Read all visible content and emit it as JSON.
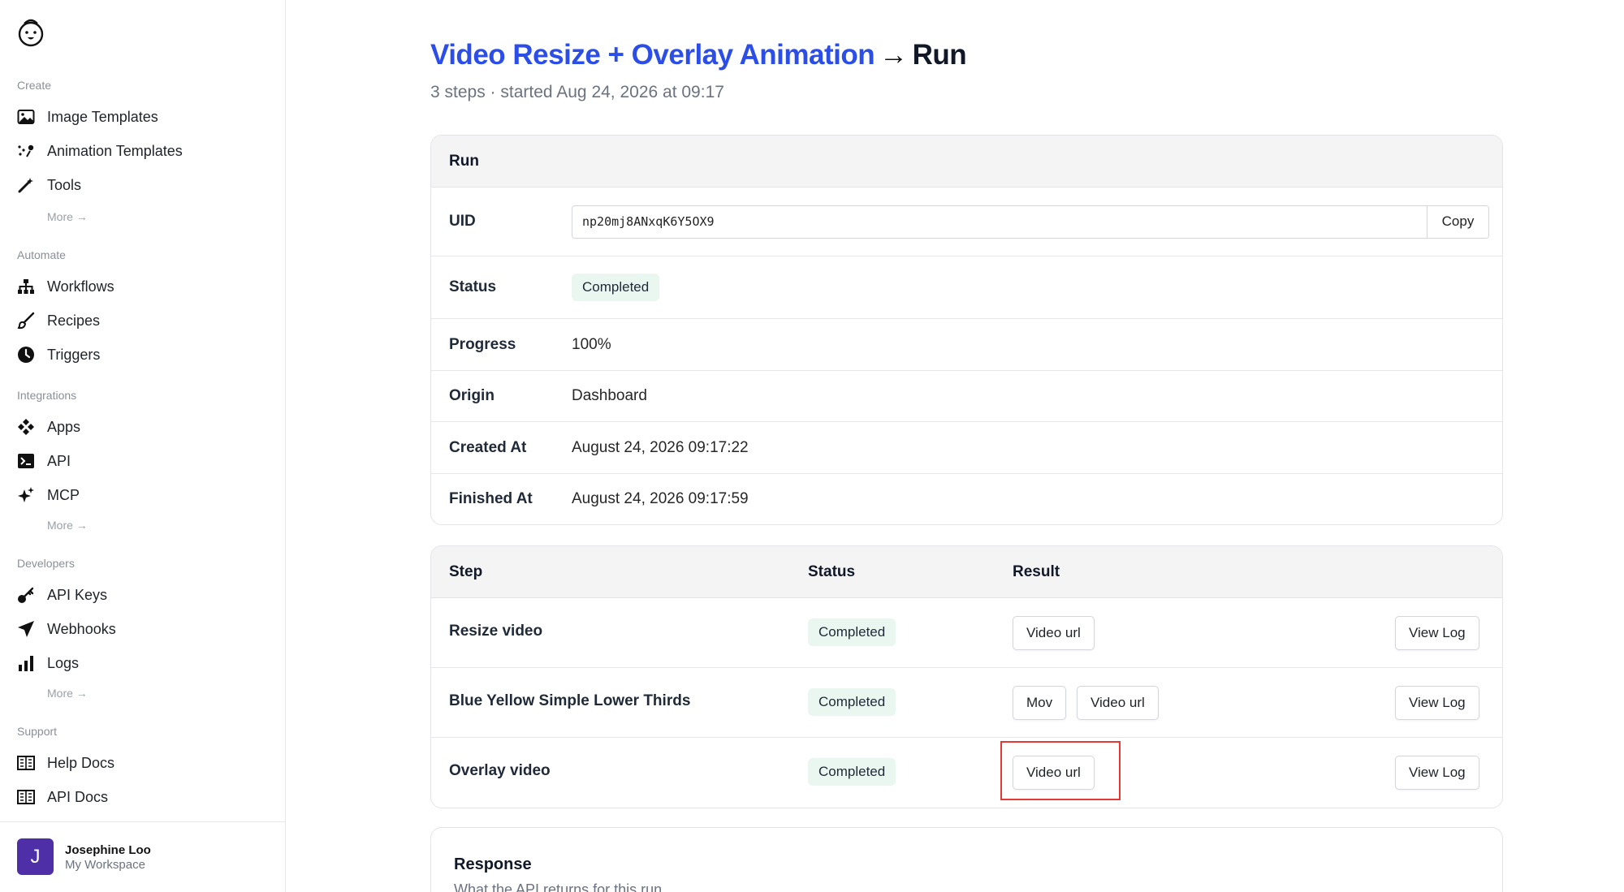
{
  "sidebar": {
    "logo_icon": "bear-logo-icon",
    "sections": {
      "create": {
        "label": "Create",
        "items": [
          {
            "label": "Image Templates",
            "icon": "image-icon"
          },
          {
            "label": "Animation Templates",
            "icon": "animation-icon"
          },
          {
            "label": "Tools",
            "icon": "magic-wand-icon"
          }
        ],
        "more": "More →"
      },
      "automate": {
        "label": "Automate",
        "items": [
          {
            "label": "Workflows",
            "icon": "workflow-icon"
          },
          {
            "label": "Recipes",
            "icon": "brush-icon"
          },
          {
            "label": "Triggers",
            "icon": "clock-icon"
          }
        ]
      },
      "integrations": {
        "label": "Integrations",
        "items": [
          {
            "label": "Apps",
            "icon": "apps-icon"
          },
          {
            "label": "API",
            "icon": "terminal-icon"
          },
          {
            "label": "MCP",
            "icon": "sparkle-icon"
          }
        ],
        "more": "More →"
      },
      "developers": {
        "label": "Developers",
        "items": [
          {
            "label": "API Keys",
            "icon": "key-icon"
          },
          {
            "label": "Webhooks",
            "icon": "send-icon"
          },
          {
            "label": "Logs",
            "icon": "bar-chart-icon"
          }
        ],
        "more": "More →"
      },
      "support": {
        "label": "Support",
        "items": [
          {
            "label": "Help Docs",
            "icon": "book-icon"
          },
          {
            "label": "API Docs",
            "icon": "book-icon"
          }
        ]
      }
    },
    "user": {
      "initial": "J",
      "name": "Josephine Loo",
      "workspace": "My Workspace",
      "avatar_color": "#4f2fa8"
    }
  },
  "header": {
    "workflow_link": "Video Resize + Overlay Animation",
    "arrow": "→",
    "page": "Run",
    "subtitle": "3 steps · started Aug 24, 2026 at 09:17"
  },
  "run": {
    "title": "Run",
    "uid_label": "UID",
    "uid_value": "np20mj8ANxqK6Y5OX9",
    "copy_label": "Copy",
    "status_label": "Status",
    "status_value": "Completed",
    "progress_label": "Progress",
    "progress_value": "100%",
    "origin_label": "Origin",
    "origin_value": "Dashboard",
    "created_label": "Created At",
    "created_value": "August 24, 2026 09:17:22",
    "finished_label": "Finished At",
    "finished_value": "August 24, 2026 09:17:59"
  },
  "steps": {
    "headers": {
      "step": "Step",
      "status": "Status",
      "result": "Result"
    },
    "rows": [
      {
        "name": "Resize video",
        "status": "Completed",
        "results": [
          "Video url"
        ],
        "log": "View Log"
      },
      {
        "name": "Blue Yellow Simple Lower Thirds",
        "status": "Completed",
        "results": [
          "Mov",
          "Video url"
        ],
        "log": "View Log"
      },
      {
        "name": "Overlay video",
        "status": "Completed",
        "results": [
          "Video url"
        ],
        "log": "View Log"
      }
    ]
  },
  "response": {
    "title": "Response",
    "subtitle": "What the API returns for this run"
  },
  "colors": {
    "accent": "#2c4ee8",
    "badge_bg": "#eaf6f0",
    "highlight": "#e53935"
  }
}
